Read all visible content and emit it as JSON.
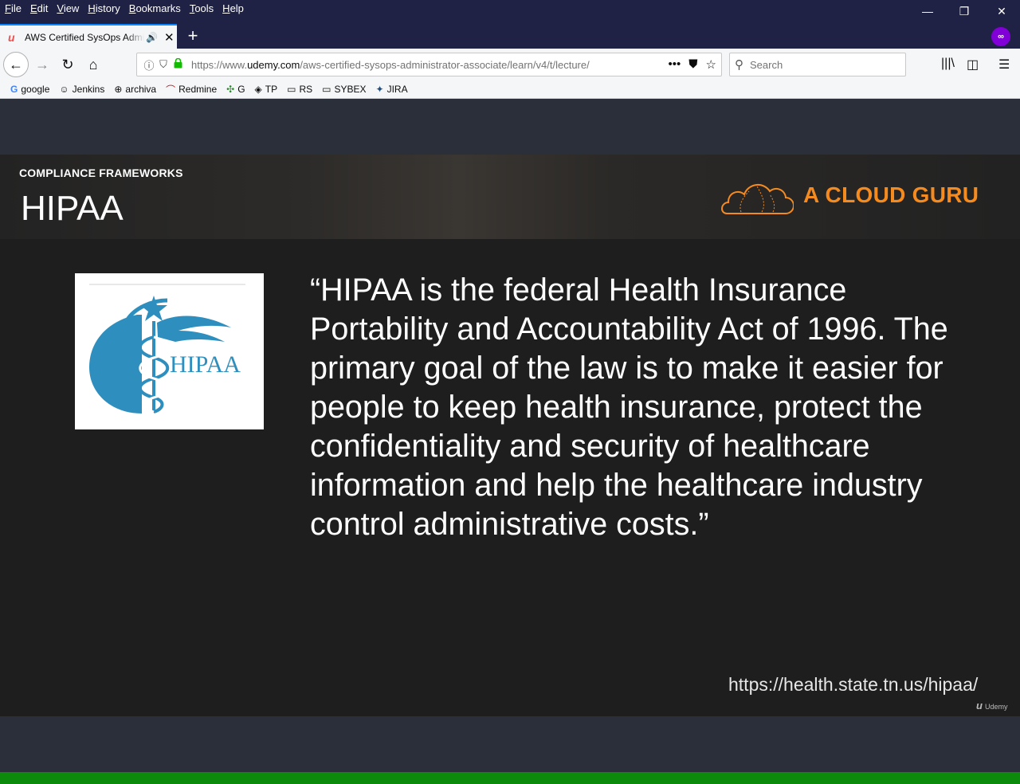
{
  "menu": [
    "File",
    "Edit",
    "View",
    "History",
    "Bookmarks",
    "Tools",
    "Help"
  ],
  "window_controls": {
    "minimize": "—",
    "restore": "❐",
    "close": "✕"
  },
  "tab": {
    "title": "AWS Certified SysOps Administrator - Associate",
    "favicon": "u",
    "new_tab": "+"
  },
  "nav": {
    "back": "←",
    "forward": "→",
    "reload": "↻",
    "home": "⌂"
  },
  "urlbar": {
    "url_prefix": "https://www.",
    "url_domain": "udemy.com",
    "url_path": "/aws-certified-sysops-administrator-associate/learn/v4/t/lecture/",
    "info_icon": "ⓘ",
    "shield_icon": "⛉",
    "lock_icon": "🔒",
    "more": "•••",
    "pocket": "⛊",
    "star": "☆"
  },
  "search": {
    "placeholder": "Search",
    "icon": "⚲"
  },
  "toolbar_icons": {
    "library": "|||\\",
    "sidebar": "◫",
    "menu": "☰"
  },
  "bookmarks": [
    {
      "label": "google",
      "icon": "G"
    },
    {
      "label": "Jenkins",
      "icon": "☺"
    },
    {
      "label": "archiva",
      "icon": "⊕"
    },
    {
      "label": "Redmine",
      "icon": "⌒"
    },
    {
      "label": "G",
      "icon": "✣"
    },
    {
      "label": "TP",
      "icon": "◈"
    },
    {
      "label": "RS",
      "icon": "▭"
    },
    {
      "label": "SYBEX",
      "icon": "▭"
    },
    {
      "label": "JIRA",
      "icon": "✦"
    }
  ],
  "slide": {
    "kicker": "COMPLIANCE FRAMEWORKS",
    "title": "HIPAA",
    "brand": "A CLOUD GURU",
    "logo_text": "HIPAA",
    "quote": "“HIPAA is the federal Health Insurance Portability and Accountability Act of 1996. The primary goal of the law is to make it easier for people to keep health insurance, protect the confidentiality and security of healthcare information and help the healthcare industry control administrative costs.”",
    "source": "https://health.state.tn.us/hipaa/",
    "watermark": "Udemy",
    "watermark_icon": "u"
  },
  "colors": {
    "brand_orange": "#f58a1f",
    "hipaa_blue": "#2e8fbf",
    "progress_green": "#0b8a0b",
    "chrome_dark": "#1f2244"
  }
}
